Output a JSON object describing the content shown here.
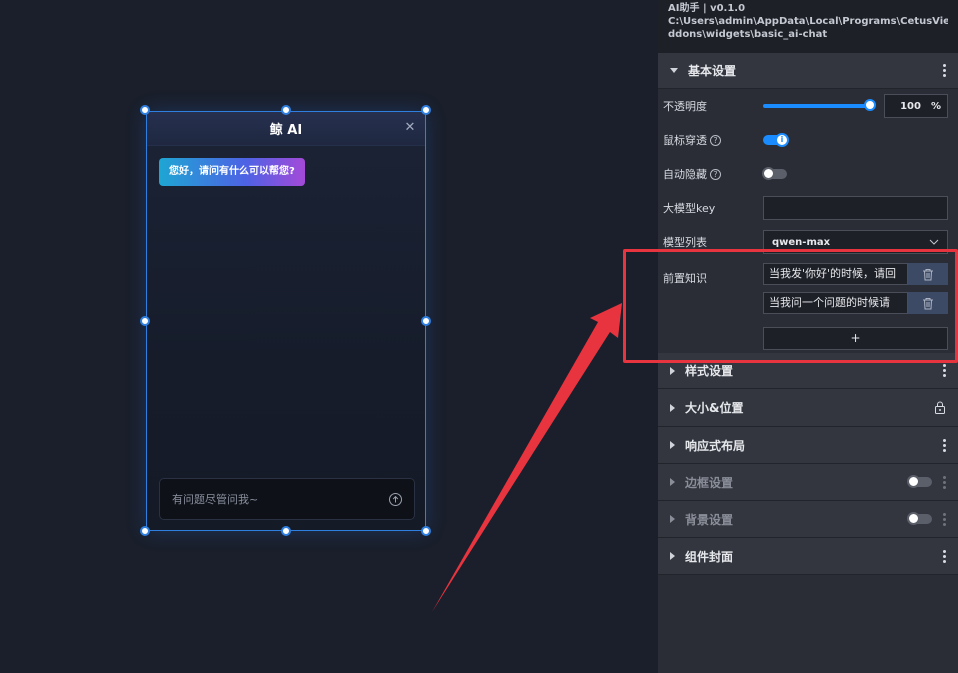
{
  "widget": {
    "title": "鲸 AI",
    "close_glyph": "✕",
    "greeting": "您好，请问有什么可以帮您?",
    "input_placeholder": "有问题尽管问我~"
  },
  "panel": {
    "info_title": "AI助手 | v0.1.0",
    "info_path_line1": "C:\\Users\\admin\\AppData\\Local\\Programs\\CetusView\\a",
    "info_path_line2": "ddons\\widgets\\basic_ai-chat",
    "basic_section": "基本设置",
    "opacity_label": "不透明度",
    "opacity_value": "100",
    "opacity_unit": "%",
    "mouse_through_label": "鼠标穿透",
    "auto_hide_label": "自动隐藏",
    "model_key_label": "大模型key",
    "model_list_label": "模型列表",
    "model_selected": "qwen-max",
    "knowledge_label": "前置知识",
    "knowledge_items": [
      "当我发'你好'的时候，请回",
      "当我问一个问题的时候请"
    ],
    "add_label": "+",
    "sections": [
      {
        "label": "样式设置"
      },
      {
        "label": "大小&位置"
      },
      {
        "label": "响应式布局"
      },
      {
        "label": "边框设置"
      },
      {
        "label": "背景设置"
      },
      {
        "label": "组件封面"
      }
    ]
  },
  "colors": {
    "accent": "#1a8cff",
    "highlight": "#e8343e",
    "selection": "#2f7fe0"
  }
}
